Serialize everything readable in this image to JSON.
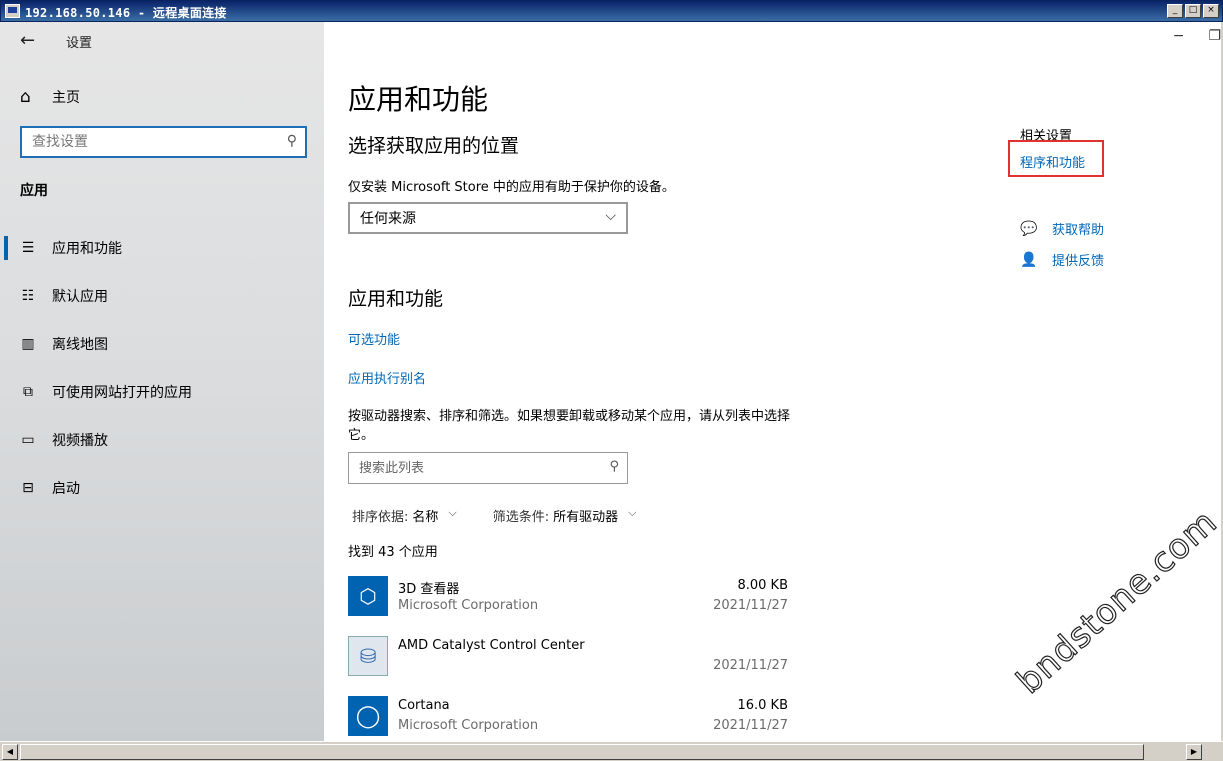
{
  "rdp": {
    "title": "192.168.50.146 - 远程桌面连接",
    "btn_min": "_",
    "btn_max": "□",
    "btn_close": "×"
  },
  "sidebar": {
    "back_icon": "back-arrow-icon",
    "title": "设置",
    "home_label": "主页",
    "search_placeholder": "查找设置",
    "section_label": "应用",
    "items": [
      {
        "label": "应用和功能",
        "icon": "apps-list-icon",
        "active": true
      },
      {
        "label": "默认应用",
        "icon": "default-apps-icon",
        "active": false
      },
      {
        "label": "离线地图",
        "icon": "map-icon",
        "active": false
      },
      {
        "label": "可使用网站打开的应用",
        "icon": "web-app-icon",
        "active": false
      },
      {
        "label": "视频播放",
        "icon": "video-icon",
        "active": false
      },
      {
        "label": "启动",
        "icon": "startup-icon",
        "active": false
      }
    ]
  },
  "main": {
    "title": "应用和功能",
    "choose_heading": "选择获取应用的位置",
    "choose_desc": "仅安装 Microsoft Store 中的应用有助于保护你的设备。",
    "source_dropdown": "任何来源",
    "apps_heading": "应用和功能",
    "link_optional": "可选功能",
    "link_alias": "应用执行别名",
    "search_desc": "按驱动器搜索、排序和筛选。如果想要卸载或移动某个应用，请从列表中选择它。",
    "search_placeholder": "搜索此列表",
    "sort_label": "排序依据:",
    "sort_value": "名称",
    "filter_label": "筛选条件:",
    "filter_value": "所有驱动器",
    "count_text": "找到 43 个应用",
    "apps": [
      {
        "name": "3D 查看器",
        "publisher": "Microsoft Corporation",
        "size": "8.00 KB",
        "date": "2021/11/27"
      },
      {
        "name": "AMD Catalyst Control Center",
        "publisher": "",
        "size": "",
        "date": "2021/11/27"
      },
      {
        "name": "Cortana",
        "publisher": "Microsoft Corporation",
        "size": "16.0 KB",
        "date": "2021/11/27"
      }
    ]
  },
  "related": {
    "title": "相关设置",
    "programs_link": "程序和功能",
    "help_link": "获取帮助",
    "feedback_link": "提供反馈"
  },
  "watermark": "bndstone.com",
  "colors": {
    "accent": "#0067b8",
    "highlight_box": "#e0302f",
    "app_tile": "#0063b1"
  }
}
